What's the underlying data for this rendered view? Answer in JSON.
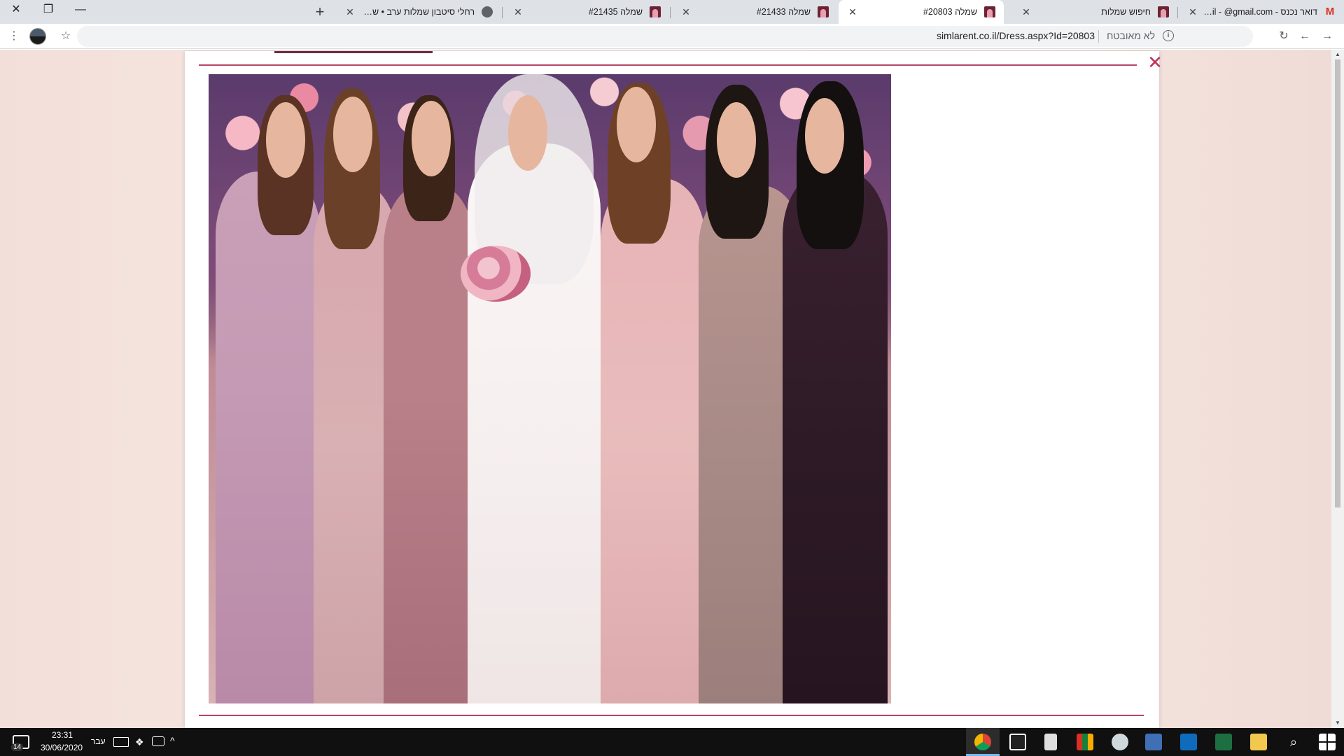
{
  "browser": {
    "tabs": [
      {
        "title": "דואר נכנס - Gmail - @gmail.com",
        "favicon": "gmail-icon",
        "active": false
      },
      {
        "title": "חיפוש שמלות",
        "favicon": "dress-icon",
        "active": false
      },
      {
        "title": "שמלה #20803",
        "favicon": "dress-icon",
        "active": true
      },
      {
        "title": "שמלה #21433",
        "favicon": "dress-icon",
        "active": false
      },
      {
        "title": "שמלה #21435",
        "favicon": "dress-icon",
        "active": false
      },
      {
        "title": "רחלי סיטבון שמלות ערב • שמחה",
        "favicon": "globe-icon",
        "active": false
      }
    ],
    "new_tab_symbol": "+",
    "window_controls": {
      "close": "✕",
      "restore": "❐",
      "minimize": "—"
    },
    "address": {
      "security_text": "לא מאובטח",
      "url": "simlarent.co.il/Dress.aspx?Id=20803"
    }
  },
  "modal": {
    "close_symbol": "✕",
    "image_alt": "שמלה #20803"
  },
  "taskbar": {
    "time": "23:31",
    "date": "30/06/2020",
    "language": "עבר",
    "notification_count": "14"
  },
  "colors": {
    "accent": "#b5466a",
    "close": "#c0305a",
    "page_bg": "#f5e3de",
    "taskbar": "#101010"
  }
}
